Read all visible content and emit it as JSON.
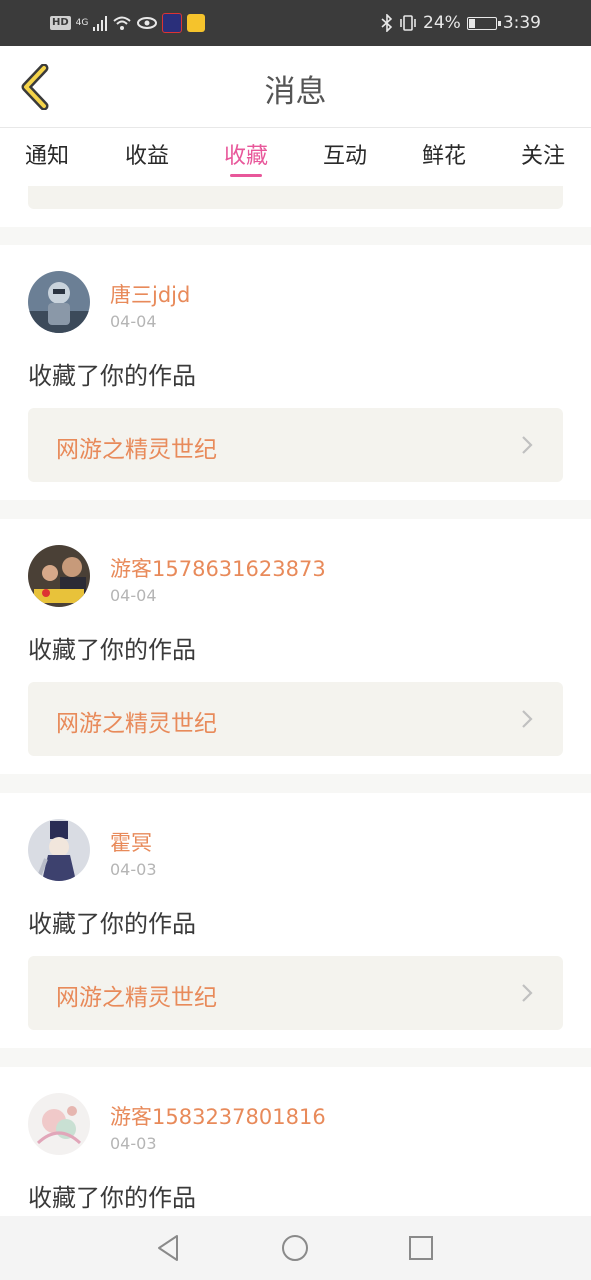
{
  "status_bar": {
    "hd": "HD",
    "network": "4G",
    "battery": "24%",
    "battery_level": 0.24,
    "time": "3:39"
  },
  "header": {
    "title": "消息",
    "back_icon": "chevron-left-icon"
  },
  "tabs": [
    {
      "label": "通知",
      "active": false
    },
    {
      "label": "收益",
      "active": false
    },
    {
      "label": "收藏",
      "active": true
    },
    {
      "label": "互动",
      "active": false
    },
    {
      "label": "鲜花",
      "active": false
    },
    {
      "label": "关注",
      "active": false
    }
  ],
  "items": [
    {
      "username": "唐三jdjd",
      "date": "04-04",
      "action": "收藏了你的作品",
      "work": "网游之精灵世纪"
    },
    {
      "username": "游客1578631623873",
      "date": "04-04",
      "action": "收藏了你的作品",
      "work": "网游之精灵世纪"
    },
    {
      "username": "霍冥",
      "date": "04-03",
      "action": "收藏了你的作品",
      "work": "网游之精灵世纪"
    },
    {
      "username": "游客1583237801816",
      "date": "04-03",
      "action": "收藏了你的作品",
      "work": ""
    }
  ],
  "colors": {
    "accent": "#e8579a",
    "username": "#e88a5a",
    "card_bg": "#f4f3ee"
  },
  "nav": [
    "back-triangle-icon",
    "home-circle-icon",
    "recents-square-icon"
  ]
}
